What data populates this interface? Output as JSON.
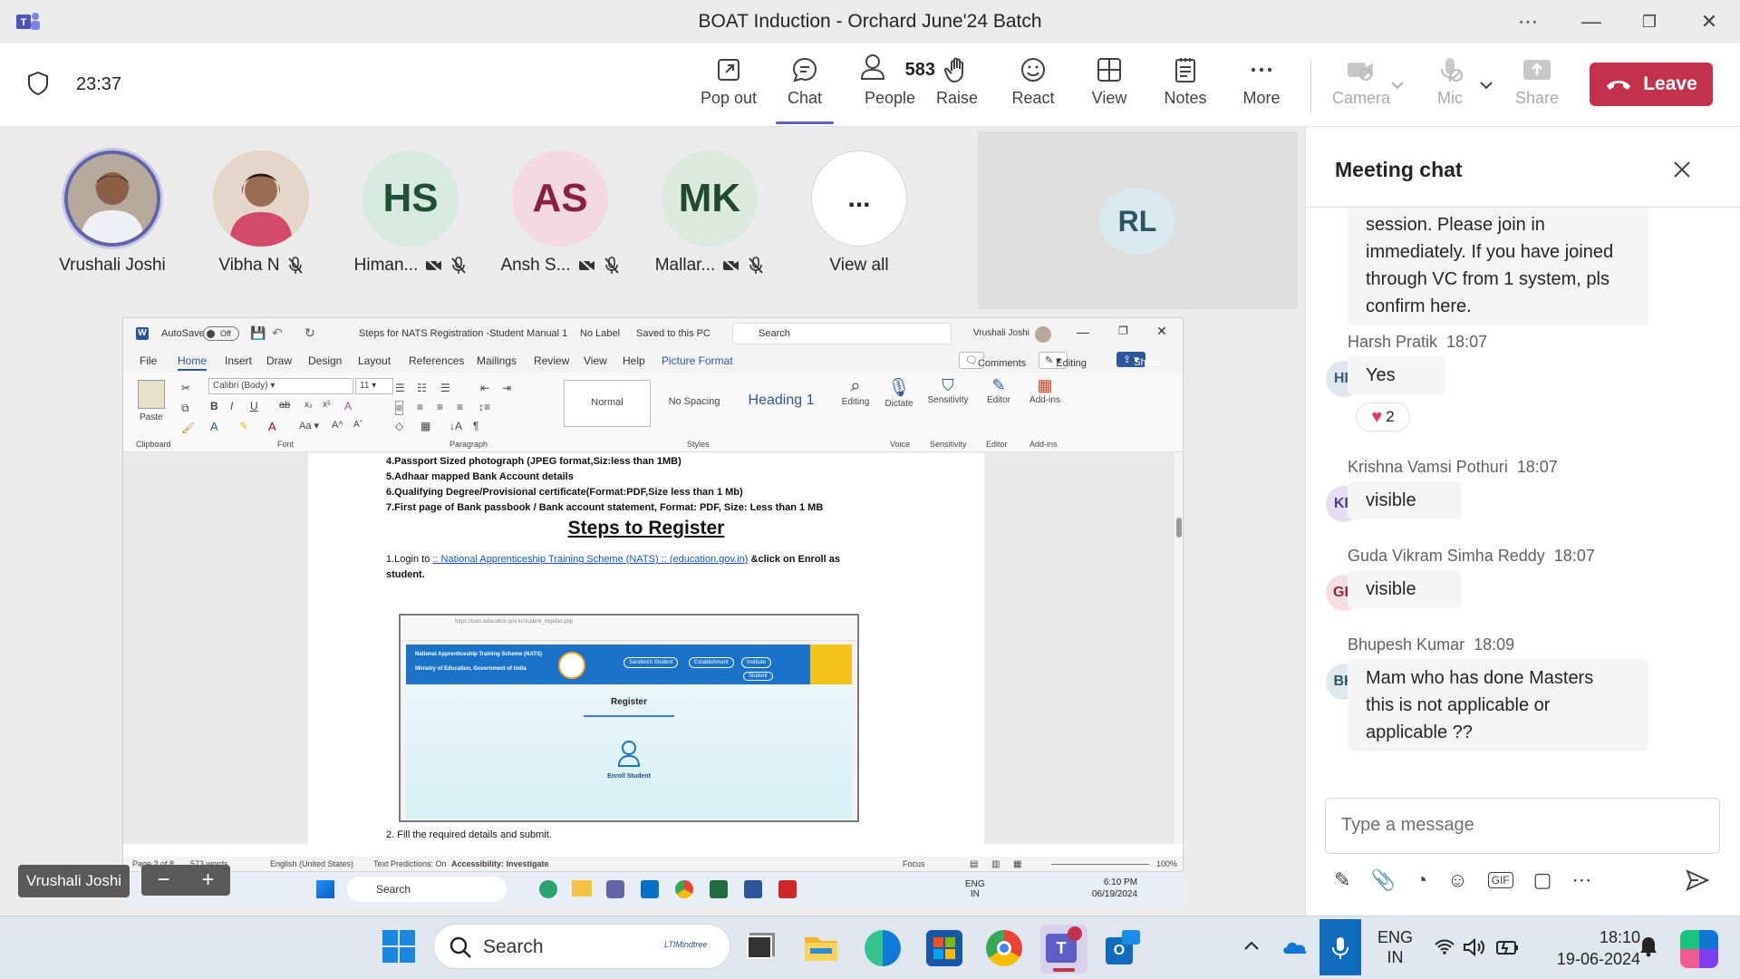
{
  "window": {
    "title": "BOAT Induction - Orchard June'24 Batch"
  },
  "toolbar": {
    "timer": "23:37",
    "buttons": [
      {
        "label": "Pop out",
        "icon": "popout-icon"
      },
      {
        "label": "Chat",
        "icon": "chat-icon"
      },
      {
        "label": "People",
        "icon": "people-icon",
        "count": "583"
      },
      {
        "label": "Raise",
        "icon": "hand-icon"
      },
      {
        "label": "React",
        "icon": "smile-icon"
      },
      {
        "label": "View",
        "icon": "grid-icon"
      },
      {
        "label": "Notes",
        "icon": "notes-icon"
      },
      {
        "label": "More",
        "icon": "more-icon"
      },
      {
        "label": "Camera",
        "icon": "camera-off-icon"
      },
      {
        "label": "Mic",
        "icon": "mic-off-icon"
      },
      {
        "label": "Share",
        "icon": "share-icon"
      }
    ],
    "leave_label": "Leave"
  },
  "participants": [
    {
      "name": "Vrushali Joshi",
      "initials": "",
      "bg": "#d9b79a"
    },
    {
      "name": "Vibha N",
      "initials": "",
      "bg": "#c9a48a"
    },
    {
      "name": "Himan...",
      "initials": "HS",
      "bg": "#d7eadf",
      "fg": "#1f5135"
    },
    {
      "name": "Ansh S...",
      "initials": "AS",
      "bg": "#f4d9e2",
      "fg": "#8a1f42"
    },
    {
      "name": "Mallar...",
      "initials": "MK",
      "bg": "#dbe9df",
      "fg": "#1f4a2f"
    },
    {
      "name": "View all",
      "initials": "...",
      "bg": "#ffffff",
      "fg": "#242424"
    }
  ],
  "spotlight": {
    "initials": "RL"
  },
  "name_tag": "Vrushali Joshi",
  "word": {
    "autosave": "AutoSave",
    "autosave_state": "Off",
    "doc_title": "Steps for NATS Registration -Student Manual 1",
    "label": "No Label",
    "saved": "Saved to this PC",
    "search": "Search",
    "user": "Vrushali Joshi",
    "menus": [
      "File",
      "Home",
      "Insert",
      "Draw",
      "Design",
      "Layout",
      "References",
      "Mailings",
      "Review",
      "View",
      "Help",
      "Picture Format"
    ],
    "comments": "Comments",
    "editing": "Editing",
    "share": "Share",
    "font": "Calibri (Body)",
    "size": "11",
    "styles": [
      "Normal",
      "No Spacing",
      "Heading 1"
    ],
    "groups": [
      "Clipboard",
      "Font",
      "Paragraph",
      "Styles",
      "Voice",
      "Sensitivity",
      "Editor",
      "Add-ins"
    ],
    "tools": [
      "Editing",
      "Dictate",
      "Sensitivity",
      "Editor",
      "Add-ins"
    ],
    "paste": "Paste",
    "doc_lines": [
      "4.Passport Sized photograph (JPEG format,Siz:less than 1MB)",
      "5.Adhaar mapped Bank Account details",
      "6.Qualifying Degree/Provisional certificate(Format:PDF,Size less than 1 Mb)",
      "7.First page of Bank passbook / Bank account statement, Format: PDF, Size: Less than 1 MB"
    ],
    "heading": "Steps to Register",
    "step1_pre": "1.Login to ",
    "step1_link": ":: National Apprenticeship Training Scheme (NATS) :: (education.gov.in)",
    "step1_post": " &click on Enroll as",
    "step1_cont": "student.",
    "step2": "2. Fill the required details and submit.",
    "screenshot": {
      "url": "https://nats.education.gov.in/student_register.php",
      "banner1": "National Apprenticeship Training Scheme (NATS)",
      "banner2": "Ministry of Education, Government of India",
      "tabs": [
        "Sandwich Student",
        "Establishment",
        "Institute",
        "Student"
      ],
      "register": "Register",
      "enroll": "Enroll Student"
    },
    "status": {
      "page": "Page 2 of 8",
      "words": "573 words",
      "lang": "English (United States)",
      "predictions": "Text Predictions: On",
      "accessibility": "Accessibility: Investigate",
      "focus": "Focus",
      "zoom": "100%"
    },
    "taskbar": {
      "search": "Search",
      "lang": "ENG",
      "region": "IN",
      "time": "6:10 PM",
      "date": "06/19/2024"
    }
  },
  "chat": {
    "header": "Meeting chat",
    "messages": [
      {
        "sender": "",
        "time": "",
        "text": "session. Please join in immediately. If you have joined through VC from 1 system, pls confirm here.",
        "initials": "",
        "lines": [
          "session. Please join in",
          "immediately. If you have joined",
          "through VC from 1 system, pls",
          "confirm here."
        ]
      },
      {
        "sender": "Harsh Pratik",
        "time": "18:07",
        "text": "Yes",
        "initials": "HP",
        "reaction": "2"
      },
      {
        "sender": "Krishna Vamsi Pothuri",
        "time": "18:07",
        "text": "visible",
        "initials": "KP"
      },
      {
        "sender": "Guda Vikram Simha Reddy",
        "time": "18:07",
        "text": "visible",
        "initials": "GR"
      },
      {
        "sender": "Bhupesh Kumar",
        "time": "18:09",
        "text": "Mam who has done Masters this is not applicable or applicable ??",
        "initials": "BK",
        "lines": [
          "Mam who has done Masters",
          "this is not applicable or",
          "applicable ??"
        ]
      }
    ],
    "input_placeholder": "Type a message"
  },
  "taskbar": {
    "search": "Search",
    "search_badge": "LTIMindtree",
    "lang": "ENG",
    "region": "IN",
    "time": "18:10",
    "date": "19-06-2024"
  }
}
